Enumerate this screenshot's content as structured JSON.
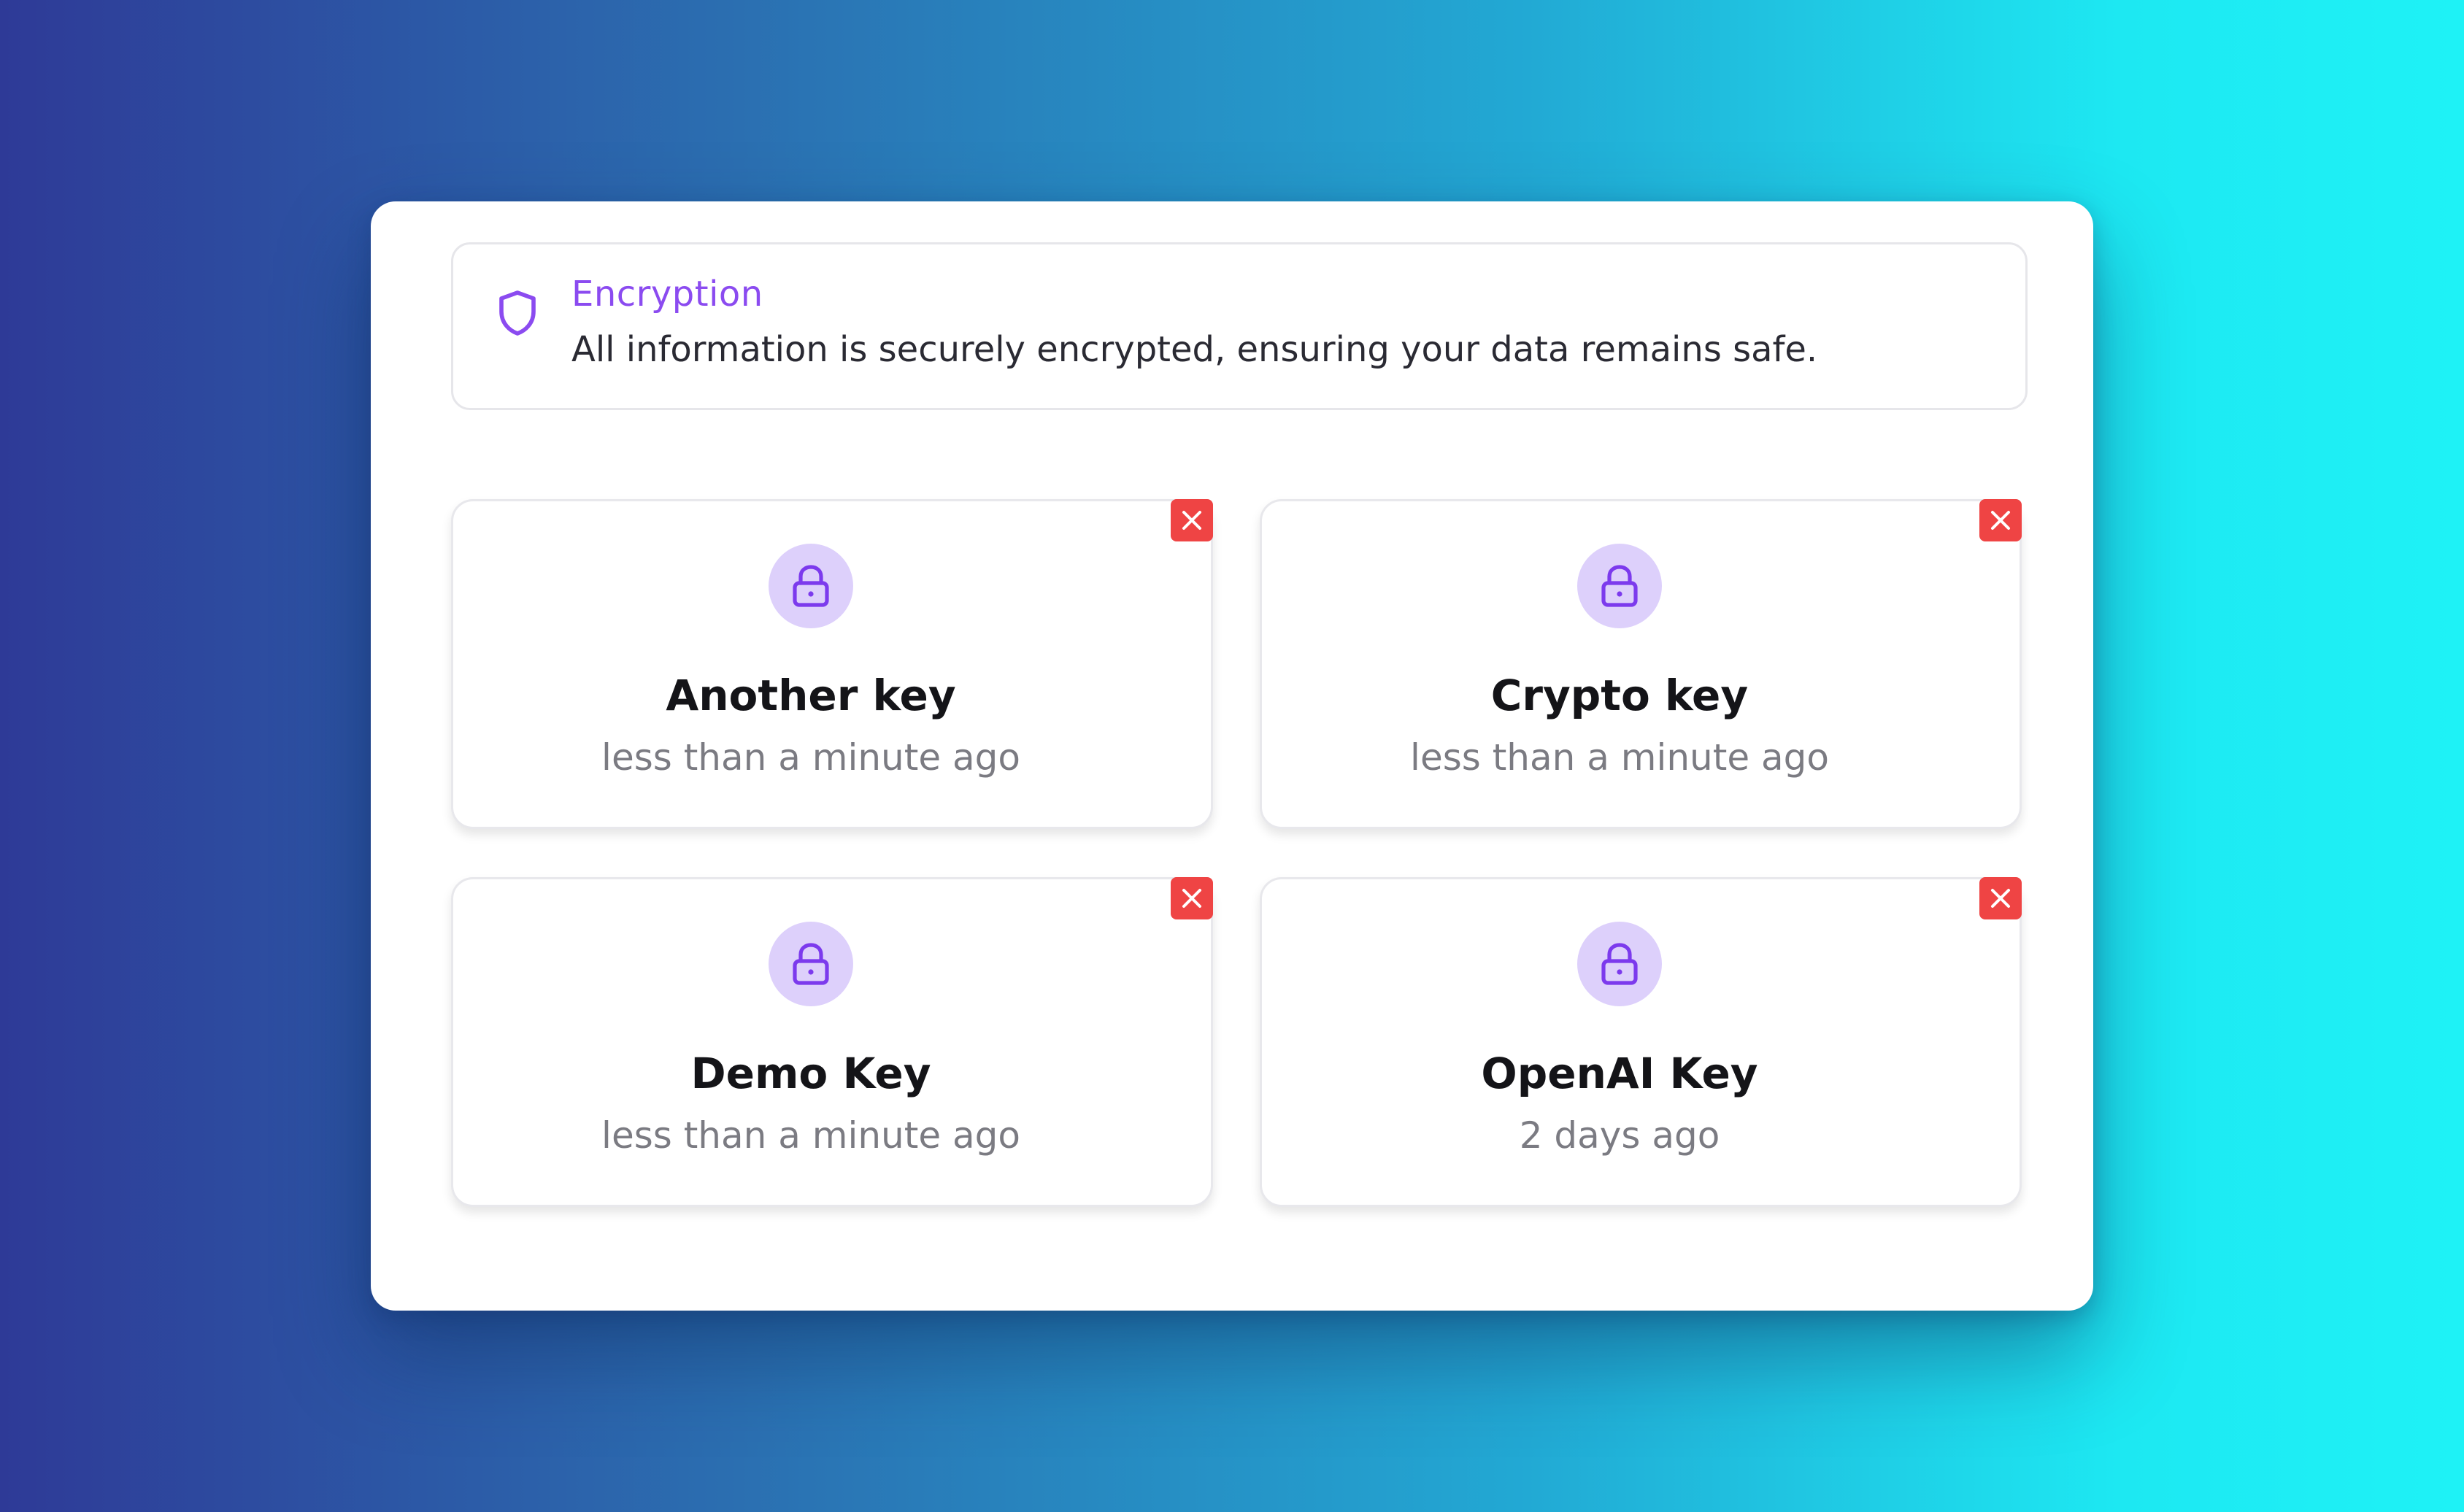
{
  "colors": {
    "accent": "#8b4bf0",
    "lock_bg": "#ddd0fb",
    "delete": "#ef4444",
    "background_start": "#2e3a97",
    "background_end": "#1ef2f6"
  },
  "banner": {
    "icon": "shield-icon",
    "title": "Encryption",
    "description": "All information is securely encrypted, ensuring your data remains safe."
  },
  "keys": [
    {
      "name": "Another key",
      "time": "less than a minute ago",
      "icon": "lock-icon",
      "delete_icon": "close-icon"
    },
    {
      "name": "Crypto key",
      "time": "less than a minute ago",
      "icon": "lock-icon",
      "delete_icon": "close-icon"
    },
    {
      "name": "Demo Key",
      "time": "less than a minute ago",
      "icon": "lock-icon",
      "delete_icon": "close-icon"
    },
    {
      "name": "OpenAI Key",
      "time": "2 days ago",
      "icon": "lock-icon",
      "delete_icon": "close-icon"
    }
  ]
}
